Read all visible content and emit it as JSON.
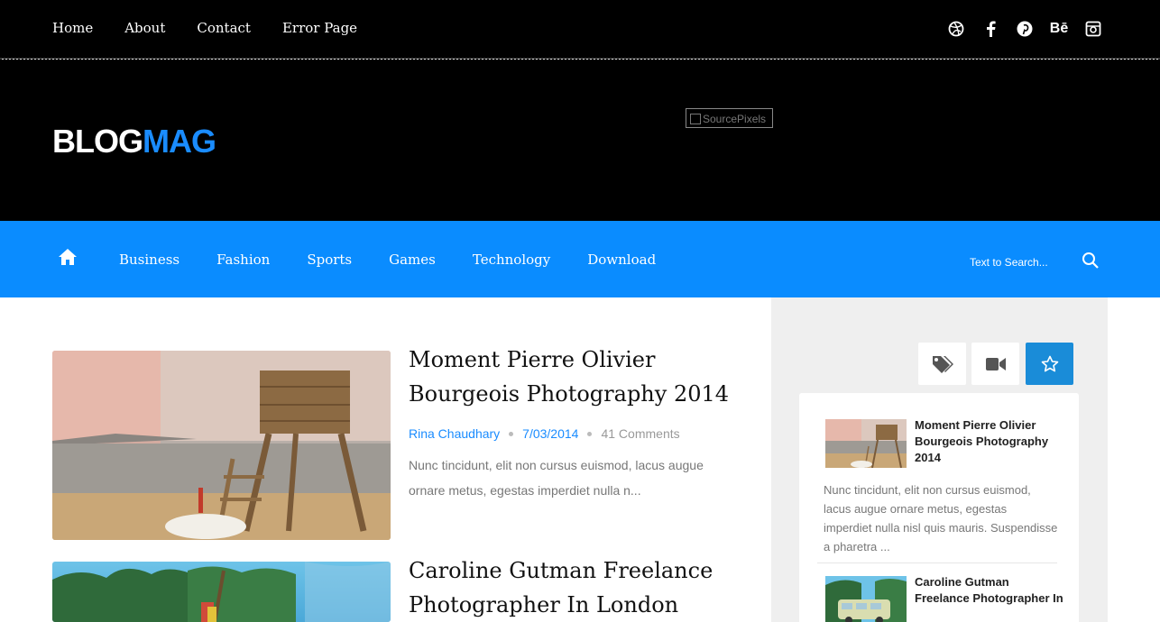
{
  "top_nav": [
    "Home",
    "About",
    "Contact",
    "Error Page"
  ],
  "social_icons": [
    "dribbble-icon",
    "facebook-icon",
    "pinterest-icon",
    "behance-icon",
    "instagram-icon"
  ],
  "logo": {
    "part1": "BLOG",
    "part2": "MAG"
  },
  "ad": {
    "alt": "SourcePixels"
  },
  "categories": [
    "Business",
    "Fashion",
    "Sports",
    "Games",
    "Technology",
    "Download"
  ],
  "search": {
    "placeholder": "Text to Search..."
  },
  "posts": [
    {
      "title": "Moment Pierre Olivier Bourgeois Photography 2014",
      "author": "Rina Chaudhary",
      "date": "7/03/2014",
      "comments": "41 Comments",
      "excerpt": "Nunc tincidunt, elit non cursus euismod, lacus augue ornare metus, egestas imperdiet nulla n..."
    },
    {
      "title": "Caroline Gutman Freelance Photographer In London"
    }
  ],
  "sidebar": {
    "tabs": [
      "tag-icon",
      "video-icon",
      "star-icon"
    ],
    "items": [
      {
        "title": "Moment Pierre Olivier Bourgeois Photography 2014",
        "excerpt": "Nunc tincidunt, elit non cursus euismod, lacus augue ornare metus, egestas imperdiet nulla nisl quis mauris. Suspendisse a pharetra ..."
      },
      {
        "title": "Caroline Gutman Freelance Photographer In"
      }
    ]
  },
  "colors": {
    "accent": "#0a8cff",
    "active_tab": "#1a8cd8"
  }
}
